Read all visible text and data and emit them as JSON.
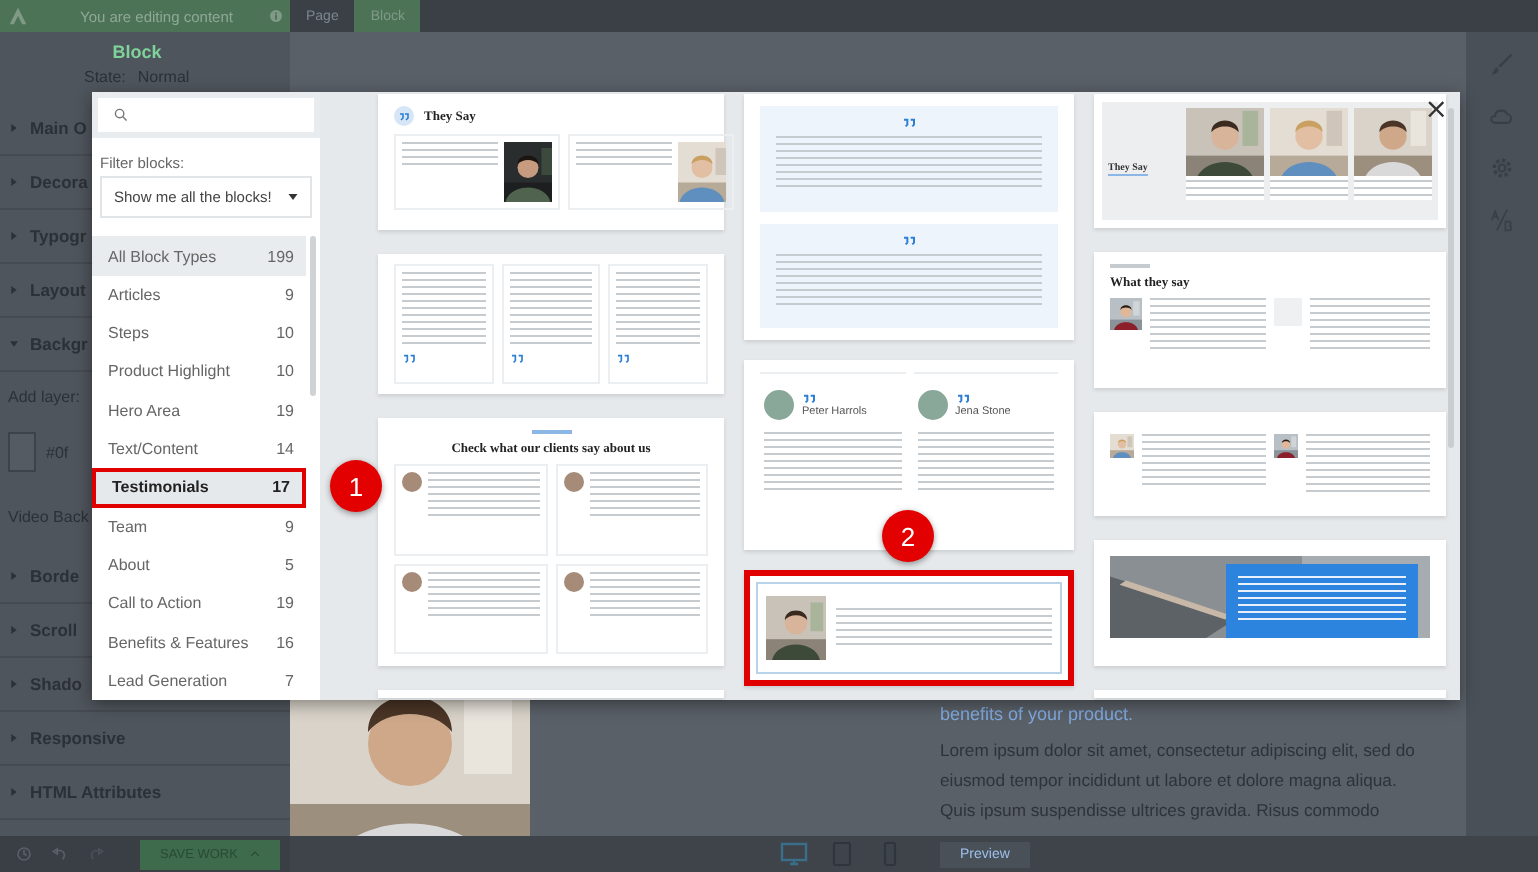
{
  "topbar": {
    "notice": "You are editing content",
    "breadcrumbs": [
      {
        "label": "Page",
        "selected": false
      },
      {
        "label": "Block",
        "selected": true
      }
    ]
  },
  "panel": {
    "title": "Block",
    "state_label": "State:",
    "state_value": "Normal",
    "sections": [
      {
        "label": "Main O",
        "expanded": false
      },
      {
        "label": "Decora",
        "expanded": false
      },
      {
        "label": "Typogr",
        "expanded": false
      },
      {
        "label": "Layout",
        "expanded": false
      },
      {
        "label": "Backgr",
        "expanded": true
      }
    ],
    "add_layer": "Add layer:",
    "color_value": "#0f",
    "video_label": "Video Back",
    "sections_after": [
      {
        "label": "Borde",
        "expanded": false
      },
      {
        "label": "Scroll",
        "expanded": false
      },
      {
        "label": "Shado",
        "expanded": false
      },
      {
        "label": "Responsive",
        "expanded": false
      },
      {
        "label": "HTML Attributes",
        "expanded": false
      }
    ]
  },
  "page": {
    "link": "benefits of your product.",
    "lines": [
      "Lorem ipsum dolor sit amet, consectetur adipiscing elit, sed do",
      "eiusmod tempor incididunt ut labore et dolore magna aliqua.",
      "Quis ipsum suspendisse ultrices gravida. Risus commodo"
    ]
  },
  "bottom": {
    "save": "SAVE WORK",
    "preview": "Preview",
    "devices": [
      {
        "kind": "desktop",
        "selected": true
      },
      {
        "kind": "tablet",
        "selected": false
      },
      {
        "kind": "phone",
        "selected": false
      }
    ]
  },
  "modal": {
    "close": "×",
    "filter_label": "Filter blocks:",
    "filter_value": "Show me all the blocks!",
    "categories": [
      {
        "label": "All Block Types",
        "count": "199",
        "kind": "total",
        "selected": false
      },
      {
        "label": "Articles",
        "count": "9",
        "kind": "type",
        "selected": false
      },
      {
        "label": "Steps",
        "count": "10",
        "kind": "type",
        "selected": false
      },
      {
        "label": "Product Highlight",
        "count": "10",
        "kind": "type",
        "selected": false
      },
      {
        "label": "Hero Area",
        "count": "19",
        "kind": "type",
        "selected": false
      },
      {
        "label": "Text/Content",
        "count": "14",
        "kind": "type",
        "selected": false
      },
      {
        "label": "Testimonials",
        "count": "17",
        "kind": "type",
        "selected": true,
        "annotation": "1"
      },
      {
        "label": "Team",
        "count": "9",
        "kind": "type",
        "selected": false
      },
      {
        "label": "About",
        "count": "5",
        "kind": "type",
        "selected": false
      },
      {
        "label": "Call to Action",
        "count": "19",
        "kind": "type",
        "selected": false
      },
      {
        "label": "Benefits & Features",
        "count": "16",
        "kind": "type",
        "selected": false
      },
      {
        "label": "Lead Generation",
        "count": "7",
        "kind": "type",
        "selected": false
      }
    ],
    "columns": [
      [
        {
          "kind": "they-say",
          "title": "They Say"
        },
        {
          "kind": "quote-cards"
        },
        {
          "kind": "clients-grid",
          "title": "Check what our clients say about us"
        },
        {
          "kind": "partial"
        }
      ],
      [
        {
          "kind": "blue-quotes"
        },
        {
          "kind": "two-people",
          "names": [
            "Peter Harrols",
            "Jena Stone"
          ]
        },
        {
          "kind": "single-quote",
          "annotation": "2"
        }
      ],
      [
        {
          "kind": "photo-row",
          "title": "They Say"
        },
        {
          "kind": "what-they-say",
          "title": "What they say"
        },
        {
          "kind": "two-col"
        },
        {
          "kind": "blue-image"
        },
        {
          "kind": "partial"
        }
      ]
    ]
  }
}
